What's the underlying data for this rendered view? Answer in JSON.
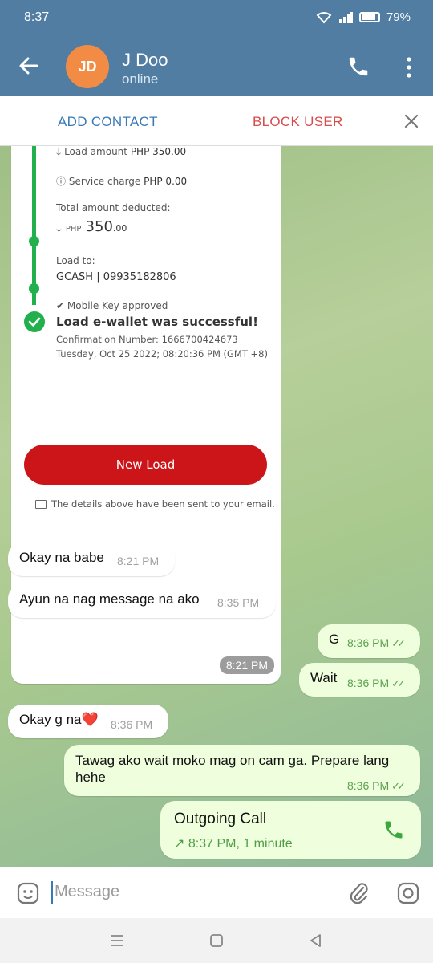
{
  "status_bar": {
    "time": "8:37",
    "battery": "79%"
  },
  "header": {
    "avatar_initials": "JD",
    "name": "J Doo",
    "status": "online"
  },
  "actions": {
    "add_contact": "ADD CONTACT",
    "block_user": "BLOCK USER"
  },
  "receipt": {
    "load_amount_label": "Load amount",
    "load_amount_value": "PHP 350.00",
    "service_charge_label": "Service charge",
    "service_charge_value": "PHP 0.00",
    "total_label": "Total amount deducted:",
    "total_currency": "PHP",
    "total_whole": "350",
    "total_cents": ".00",
    "load_to_label": "Load to:",
    "load_to_value": "GCASH | 09935182806",
    "mobile_key": "Mobile Key approved",
    "success_title": "Load e-wallet was successful!",
    "confirmation": "Confirmation Number: 1666700424673",
    "datetime": "Tuesday, Oct 25 2022; 08:20:36 PM (GMT +8)",
    "new_load_button": "New Load",
    "email_note": "The details above have been sent to your email.",
    "time": "8:21 PM"
  },
  "messages": [
    {
      "direction": "in",
      "text": "Okay na babe",
      "time": "8:21 PM"
    },
    {
      "direction": "in",
      "text": "Ayun na nag message na ako",
      "time": "8:35 PM"
    },
    {
      "direction": "out",
      "text": "G",
      "time": "8:36 PM"
    },
    {
      "direction": "out",
      "text": "Wait",
      "time": "8:36 PM"
    },
    {
      "direction": "in",
      "text": "Okay g na❤️",
      "time": "8:36 PM"
    },
    {
      "direction": "out",
      "text": "Tawag ako wait moko mag on cam ga. Prepare lang hehe",
      "time": "8:36 PM"
    }
  ],
  "call": {
    "title": "Outgoing Call",
    "info": "8:37 PM, 1 minute"
  },
  "input": {
    "placeholder": "Message"
  },
  "colors": {
    "header": "#517da2",
    "outgoing_bubble": "#effedd",
    "accent_green": "#21b04b",
    "new_load_red": "#cc1518"
  }
}
